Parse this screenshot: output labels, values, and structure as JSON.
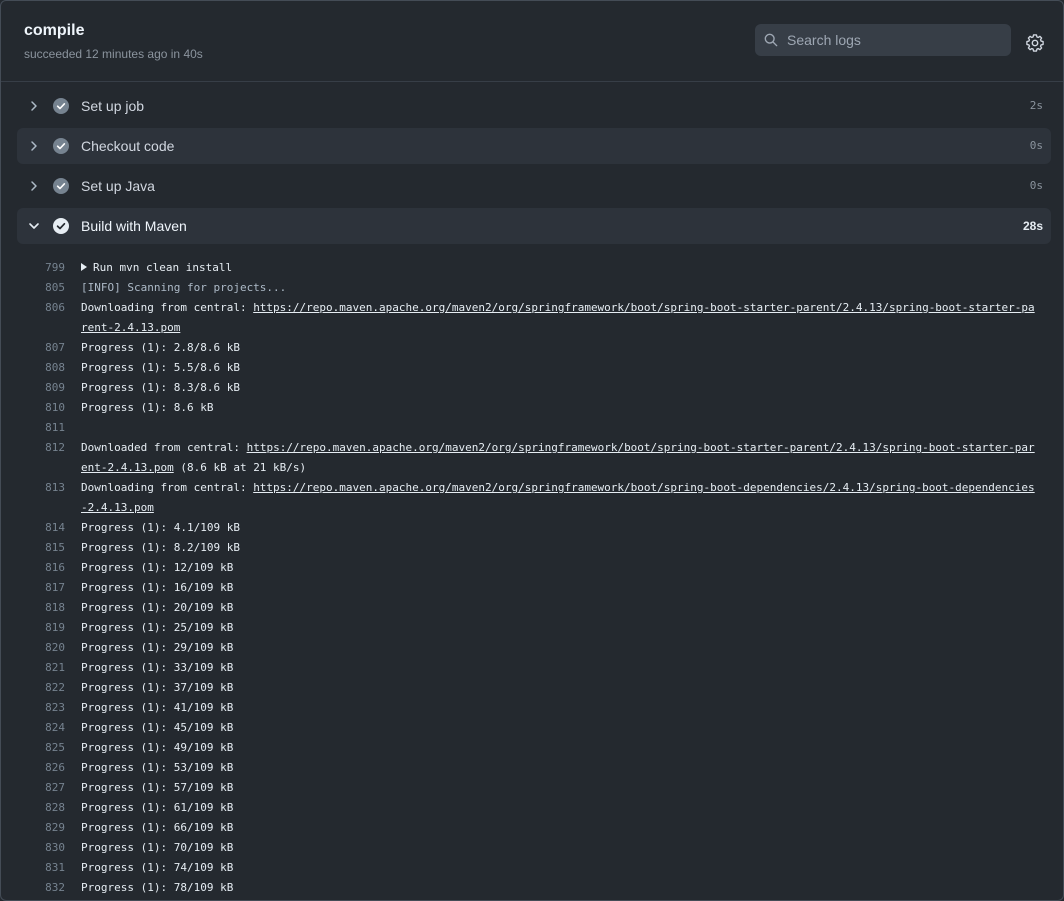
{
  "header": {
    "title": "compile",
    "status": "succeeded 12 minutes ago in 40s"
  },
  "search": {
    "placeholder": "Search logs",
    "icon": "search-icon"
  },
  "settings": {
    "icon": "gear-icon"
  },
  "colors": {
    "background": "#24292f",
    "step_highlight": "#2d333b",
    "check_fill": "#768390"
  },
  "steps": [
    {
      "name": "Set up job",
      "duration": "2s",
      "expanded": false
    },
    {
      "name": "Checkout code",
      "duration": "0s",
      "expanded": false
    },
    {
      "name": "Set up Java",
      "duration": "0s",
      "expanded": false
    },
    {
      "name": "Build with Maven",
      "duration": "28s",
      "expanded": true
    }
  ],
  "log": [
    {
      "n": "799",
      "text": "Run mvn clean install",
      "group": true
    },
    {
      "n": "805",
      "text": "[INFO] Scanning for projects...",
      "dim": true
    },
    {
      "n": "806",
      "pre": "Downloading from central: ",
      "link": "https://repo.maven.apache.org/maven2/org/springframework/boot/spring-boot-starter-parent/2.4.13/spring-boot-starter-parent-2.4.13.pom",
      "post": ""
    },
    {
      "n": "807",
      "text": "Progress (1): 2.8/8.6 kB"
    },
    {
      "n": "808",
      "text": "Progress (1): 5.5/8.6 kB"
    },
    {
      "n": "809",
      "text": "Progress (1): 8.3/8.6 kB"
    },
    {
      "n": "810",
      "text": "Progress (1): 8.6 kB"
    },
    {
      "n": "811",
      "text": ""
    },
    {
      "n": "812",
      "pre": "Downloaded from central: ",
      "link": "https://repo.maven.apache.org/maven2/org/springframework/boot/spring-boot-starter-parent/2.4.13/spring-boot-starter-parent-2.4.13.pom",
      "post": " (8.6 kB at 21 kB/s)"
    },
    {
      "n": "813",
      "pre": "Downloading from central: ",
      "link": "https://repo.maven.apache.org/maven2/org/springframework/boot/spring-boot-dependencies/2.4.13/spring-boot-dependencies-2.4.13.pom",
      "post": ""
    },
    {
      "n": "814",
      "text": "Progress (1): 4.1/109 kB"
    },
    {
      "n": "815",
      "text": "Progress (1): 8.2/109 kB"
    },
    {
      "n": "816",
      "text": "Progress (1): 12/109 kB"
    },
    {
      "n": "817",
      "text": "Progress (1): 16/109 kB"
    },
    {
      "n": "818",
      "text": "Progress (1): 20/109 kB"
    },
    {
      "n": "819",
      "text": "Progress (1): 25/109 kB"
    },
    {
      "n": "820",
      "text": "Progress (1): 29/109 kB"
    },
    {
      "n": "821",
      "text": "Progress (1): 33/109 kB"
    },
    {
      "n": "822",
      "text": "Progress (1): 37/109 kB"
    },
    {
      "n": "823",
      "text": "Progress (1): 41/109 kB"
    },
    {
      "n": "824",
      "text": "Progress (1): 45/109 kB"
    },
    {
      "n": "825",
      "text": "Progress (1): 49/109 kB"
    },
    {
      "n": "826",
      "text": "Progress (1): 53/109 kB"
    },
    {
      "n": "827",
      "text": "Progress (1): 57/109 kB"
    },
    {
      "n": "828",
      "text": "Progress (1): 61/109 kB"
    },
    {
      "n": "829",
      "text": "Progress (1): 66/109 kB"
    },
    {
      "n": "830",
      "text": "Progress (1): 70/109 kB"
    },
    {
      "n": "831",
      "text": "Progress (1): 74/109 kB"
    },
    {
      "n": "832",
      "text": "Progress (1): 78/109 kB"
    }
  ]
}
